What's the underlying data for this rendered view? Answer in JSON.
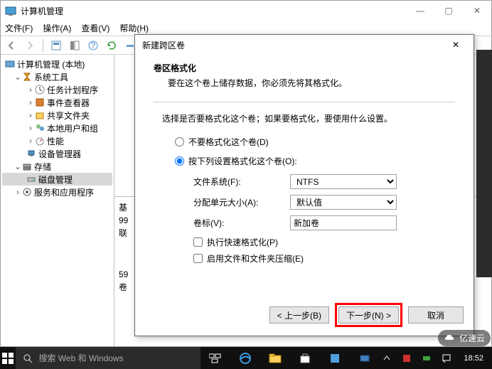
{
  "window": {
    "title": "计算机管理",
    "menus": {
      "file": "文件(F)",
      "action": "操作(A)",
      "view": "查看(V)",
      "help": "帮助(H)"
    },
    "winbtns": {
      "min": "—",
      "max": "▢",
      "close": "✕"
    }
  },
  "tree": {
    "root": "计算机管理 (本地)",
    "sys_tools": "系统工具",
    "task_sched": "任务计划程序",
    "event_viewer": "事件查看器",
    "shared_folders": "共享文件夹",
    "local_users": "本地用户和组",
    "performance": "性能",
    "device_mgr": "设备管理器",
    "storage": "存储",
    "disk_mgmt": "磁盘管理",
    "services": "服务和应用程序"
  },
  "right": {
    "basic": "基",
    "val99": "99",
    "online": "联",
    "val59": "59",
    "vol": "卷"
  },
  "dialog": {
    "title": "新建跨区卷",
    "close": "✕",
    "heading": "卷区格式化",
    "subheading": "要在这个卷上储存数据，你必须先将其格式化。",
    "desc": "选择是否要格式化这个卷；如果要格式化，要使用什么设置。",
    "radio1": "不要格式化这个卷(D)",
    "radio2": "按下列设置格式化这个卷(O):",
    "fs_label": "文件系统(F):",
    "fs_value": "NTFS",
    "alloc_label": "分配单元大小(A):",
    "alloc_value": "默认值",
    "vol_label": "卷标(V):",
    "vol_value": "新加卷",
    "quick": "执行快速格式化(P)",
    "compress": "启用文件和文件夹压缩(E)",
    "back": "< 上一步(B)",
    "next": "下一步(N) >",
    "cancel": "取消"
  },
  "taskbar": {
    "search_placeholder": "搜索 Web 和 Windows",
    "clock": "18:52",
    "brand": "亿速云"
  }
}
